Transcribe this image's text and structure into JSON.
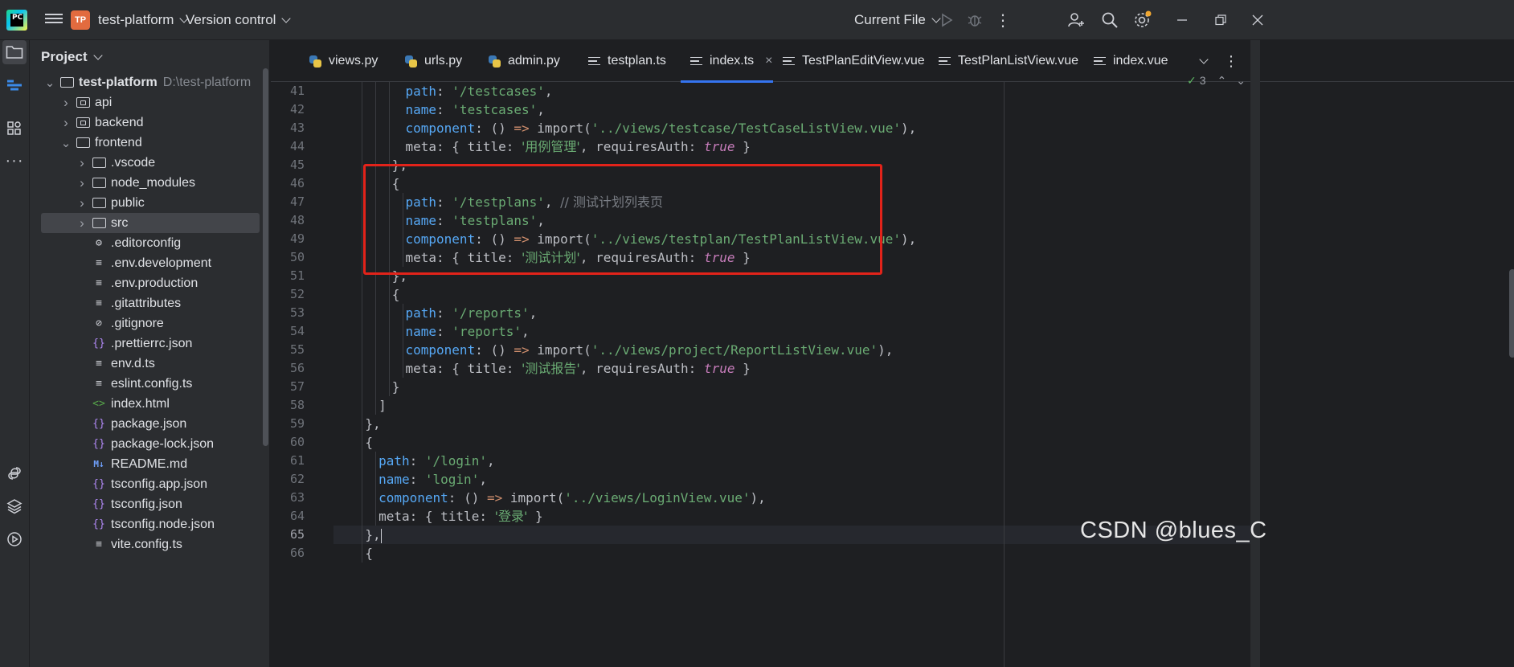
{
  "titlebar": {
    "project_badge": "TP",
    "project_name": "test-platform",
    "vcs": "Version control",
    "run_config": "Current File"
  },
  "project_panel": {
    "title": "Project",
    "tree": [
      {
        "label": "test-platform",
        "hint": "D:\\test-platform",
        "type": "folder",
        "expanded": true,
        "depth": 0
      },
      {
        "label": "api",
        "type": "folder",
        "expanded": false,
        "depth": 1
      },
      {
        "label": "backend",
        "type": "folder",
        "expanded": false,
        "depth": 1
      },
      {
        "label": "frontend",
        "type": "folder",
        "expanded": true,
        "depth": 1
      },
      {
        "label": ".vscode",
        "type": "folder",
        "expanded": false,
        "depth": 2
      },
      {
        "label": "node_modules",
        "type": "folder",
        "expanded": false,
        "depth": 2
      },
      {
        "label": "public",
        "type": "folder",
        "expanded": false,
        "depth": 2
      },
      {
        "label": "src",
        "type": "folder",
        "expanded": false,
        "depth": 2,
        "selected": true
      },
      {
        "label": ".editorconfig",
        "type": "gear",
        "depth": 2
      },
      {
        "label": ".env.development",
        "type": "text",
        "depth": 2
      },
      {
        "label": ".env.production",
        "type": "text",
        "depth": 2
      },
      {
        "label": ".gitattributes",
        "type": "text",
        "depth": 2
      },
      {
        "label": ".gitignore",
        "type": "ignore",
        "depth": 2
      },
      {
        "label": ".prettierrc.json",
        "type": "json",
        "depth": 2
      },
      {
        "label": "env.d.ts",
        "type": "text",
        "depth": 2
      },
      {
        "label": "eslint.config.ts",
        "type": "text",
        "depth": 2
      },
      {
        "label": "index.html",
        "type": "html",
        "depth": 2
      },
      {
        "label": "package.json",
        "type": "json",
        "depth": 2
      },
      {
        "label": "package-lock.json",
        "type": "json",
        "depth": 2
      },
      {
        "label": "README.md",
        "type": "md",
        "depth": 2
      },
      {
        "label": "tsconfig.app.json",
        "type": "json",
        "depth": 2
      },
      {
        "label": "tsconfig.json",
        "type": "json",
        "depth": 2
      },
      {
        "label": "tsconfig.node.json",
        "type": "json",
        "depth": 2
      },
      {
        "label": "vite.config.ts",
        "type": "text",
        "depth": 2
      }
    ]
  },
  "tabs": [
    {
      "label": "views.py",
      "icon": "python-icon"
    },
    {
      "label": "urls.py",
      "icon": "python-icon"
    },
    {
      "label": "admin.py",
      "icon": "python-icon"
    },
    {
      "label": "testplan.ts",
      "icon": "text-file-icon"
    },
    {
      "label": "index.ts",
      "icon": "text-file-icon",
      "active": true
    },
    {
      "label": "TestPlanEditView.vue",
      "icon": "text-file-icon"
    },
    {
      "label": "TestPlanListView.vue",
      "icon": "text-file-icon"
    },
    {
      "label": "index.vue",
      "icon": "text-file-icon"
    }
  ],
  "inspection_count": "3",
  "current_line": 65,
  "code_lines": [
    {
      "n": "41",
      "indent": 10,
      "tokens": [
        [
          "p",
          "path"
        ],
        [
          "t",
          ": "
        ],
        [
          "s",
          "'/testcases'"
        ],
        [
          "t",
          ","
        ]
      ]
    },
    {
      "n": "42",
      "indent": 10,
      "tokens": [
        [
          "p",
          "name"
        ],
        [
          "t",
          ": "
        ],
        [
          "s",
          "'testcases'"
        ],
        [
          "t",
          ","
        ]
      ]
    },
    {
      "n": "43",
      "indent": 10,
      "tokens": [
        [
          "p",
          "component"
        ],
        [
          "t",
          ": () "
        ],
        [
          "k",
          "=>"
        ],
        [
          "t",
          " import("
        ],
        [
          "s",
          "'../views/testcase/TestCaseListView.vue'"
        ],
        [
          "t",
          "),"
        ]
      ]
    },
    {
      "n": "44",
      "indent": 10,
      "tokens": [
        [
          "t",
          "meta: { title: "
        ],
        [
          "s",
          "'用例管理'"
        ],
        [
          "t",
          ", requiresAuth: "
        ],
        [
          "kw",
          "true"
        ],
        [
          "t",
          " }"
        ]
      ]
    },
    {
      "n": "45",
      "indent": 8,
      "tokens": [
        [
          "t",
          "},"
        ]
      ]
    },
    {
      "n": "46",
      "indent": 8,
      "tokens": [
        [
          "t",
          "{"
        ]
      ]
    },
    {
      "n": "47",
      "indent": 10,
      "tokens": [
        [
          "p",
          "path"
        ],
        [
          "t",
          ": "
        ],
        [
          "s",
          "'/testplans'"
        ],
        [
          "t",
          ", "
        ],
        [
          "c",
          "// 测试计划列表页"
        ]
      ]
    },
    {
      "n": "48",
      "indent": 10,
      "tokens": [
        [
          "p",
          "name"
        ],
        [
          "t",
          ": "
        ],
        [
          "s",
          "'testplans'"
        ],
        [
          "t",
          ","
        ]
      ]
    },
    {
      "n": "49",
      "indent": 10,
      "tokens": [
        [
          "p",
          "component"
        ],
        [
          "t",
          ": () "
        ],
        [
          "k",
          "=>"
        ],
        [
          "t",
          " import("
        ],
        [
          "s",
          "'../views/testplan/TestPlanListView.vue'"
        ],
        [
          "t",
          "),"
        ]
      ]
    },
    {
      "n": "50",
      "indent": 10,
      "tokens": [
        [
          "t",
          "meta: { title: "
        ],
        [
          "s",
          "'测试计划'"
        ],
        [
          "t",
          ", requiresAuth: "
        ],
        [
          "kw",
          "true"
        ],
        [
          "t",
          " }"
        ]
      ]
    },
    {
      "n": "51",
      "indent": 8,
      "tokens": [
        [
          "t",
          "},"
        ]
      ]
    },
    {
      "n": "52",
      "indent": 8,
      "tokens": [
        [
          "t",
          "{"
        ]
      ]
    },
    {
      "n": "53",
      "indent": 10,
      "tokens": [
        [
          "p",
          "path"
        ],
        [
          "t",
          ": "
        ],
        [
          "s",
          "'/reports'"
        ],
        [
          "t",
          ","
        ]
      ]
    },
    {
      "n": "54",
      "indent": 10,
      "tokens": [
        [
          "p",
          "name"
        ],
        [
          "t",
          ": "
        ],
        [
          "s",
          "'reports'"
        ],
        [
          "t",
          ","
        ]
      ]
    },
    {
      "n": "55",
      "indent": 10,
      "tokens": [
        [
          "p",
          "component"
        ],
        [
          "t",
          ": () "
        ],
        [
          "k",
          "=>"
        ],
        [
          "t",
          " import("
        ],
        [
          "s",
          "'../views/project/ReportListView.vue'"
        ],
        [
          "t",
          "),"
        ]
      ]
    },
    {
      "n": "56",
      "indent": 10,
      "tokens": [
        [
          "t",
          "meta: { title: "
        ],
        [
          "s",
          "'测试报告'"
        ],
        [
          "t",
          ", requiresAuth: "
        ],
        [
          "kw",
          "true"
        ],
        [
          "t",
          " }"
        ]
      ]
    },
    {
      "n": "57",
      "indent": 8,
      "tokens": [
        [
          "t",
          "}"
        ]
      ]
    },
    {
      "n": "58",
      "indent": 6,
      "tokens": [
        [
          "t",
          "]"
        ]
      ]
    },
    {
      "n": "59",
      "indent": 4,
      "tokens": [
        [
          "t",
          "},"
        ]
      ]
    },
    {
      "n": "60",
      "indent": 4,
      "tokens": [
        [
          "t",
          "{"
        ]
      ]
    },
    {
      "n": "61",
      "indent": 6,
      "tokens": [
        [
          "p",
          "path"
        ],
        [
          "t",
          ": "
        ],
        [
          "s",
          "'/login'"
        ],
        [
          "t",
          ","
        ]
      ]
    },
    {
      "n": "62",
      "indent": 6,
      "tokens": [
        [
          "p",
          "name"
        ],
        [
          "t",
          ": "
        ],
        [
          "s",
          "'login'"
        ],
        [
          "t",
          ","
        ]
      ]
    },
    {
      "n": "63",
      "indent": 6,
      "tokens": [
        [
          "p",
          "component"
        ],
        [
          "t",
          ": () "
        ],
        [
          "k",
          "=>"
        ],
        [
          "t",
          " import("
        ],
        [
          "s",
          "'../views/LoginView.vue'"
        ],
        [
          "t",
          "),"
        ]
      ]
    },
    {
      "n": "64",
      "indent": 6,
      "tokens": [
        [
          "t",
          "meta: { title: "
        ],
        [
          "s",
          "'登录'"
        ],
        [
          "t",
          " }"
        ]
      ]
    },
    {
      "n": "65",
      "indent": 4,
      "tokens": [
        [
          "t",
          "},"
        ]
      ]
    },
    {
      "n": "66",
      "indent": 4,
      "tokens": [
        [
          "t",
          "{"
        ]
      ]
    }
  ],
  "watermark": "CSDN @blues_C",
  "colors": {
    "accent": "#3574f0",
    "highlight_box": "#e2231a",
    "string": "#6aab73",
    "property": "#56a8f5",
    "keyword": "#cf8e6d",
    "boolean": "#c77dbb"
  }
}
